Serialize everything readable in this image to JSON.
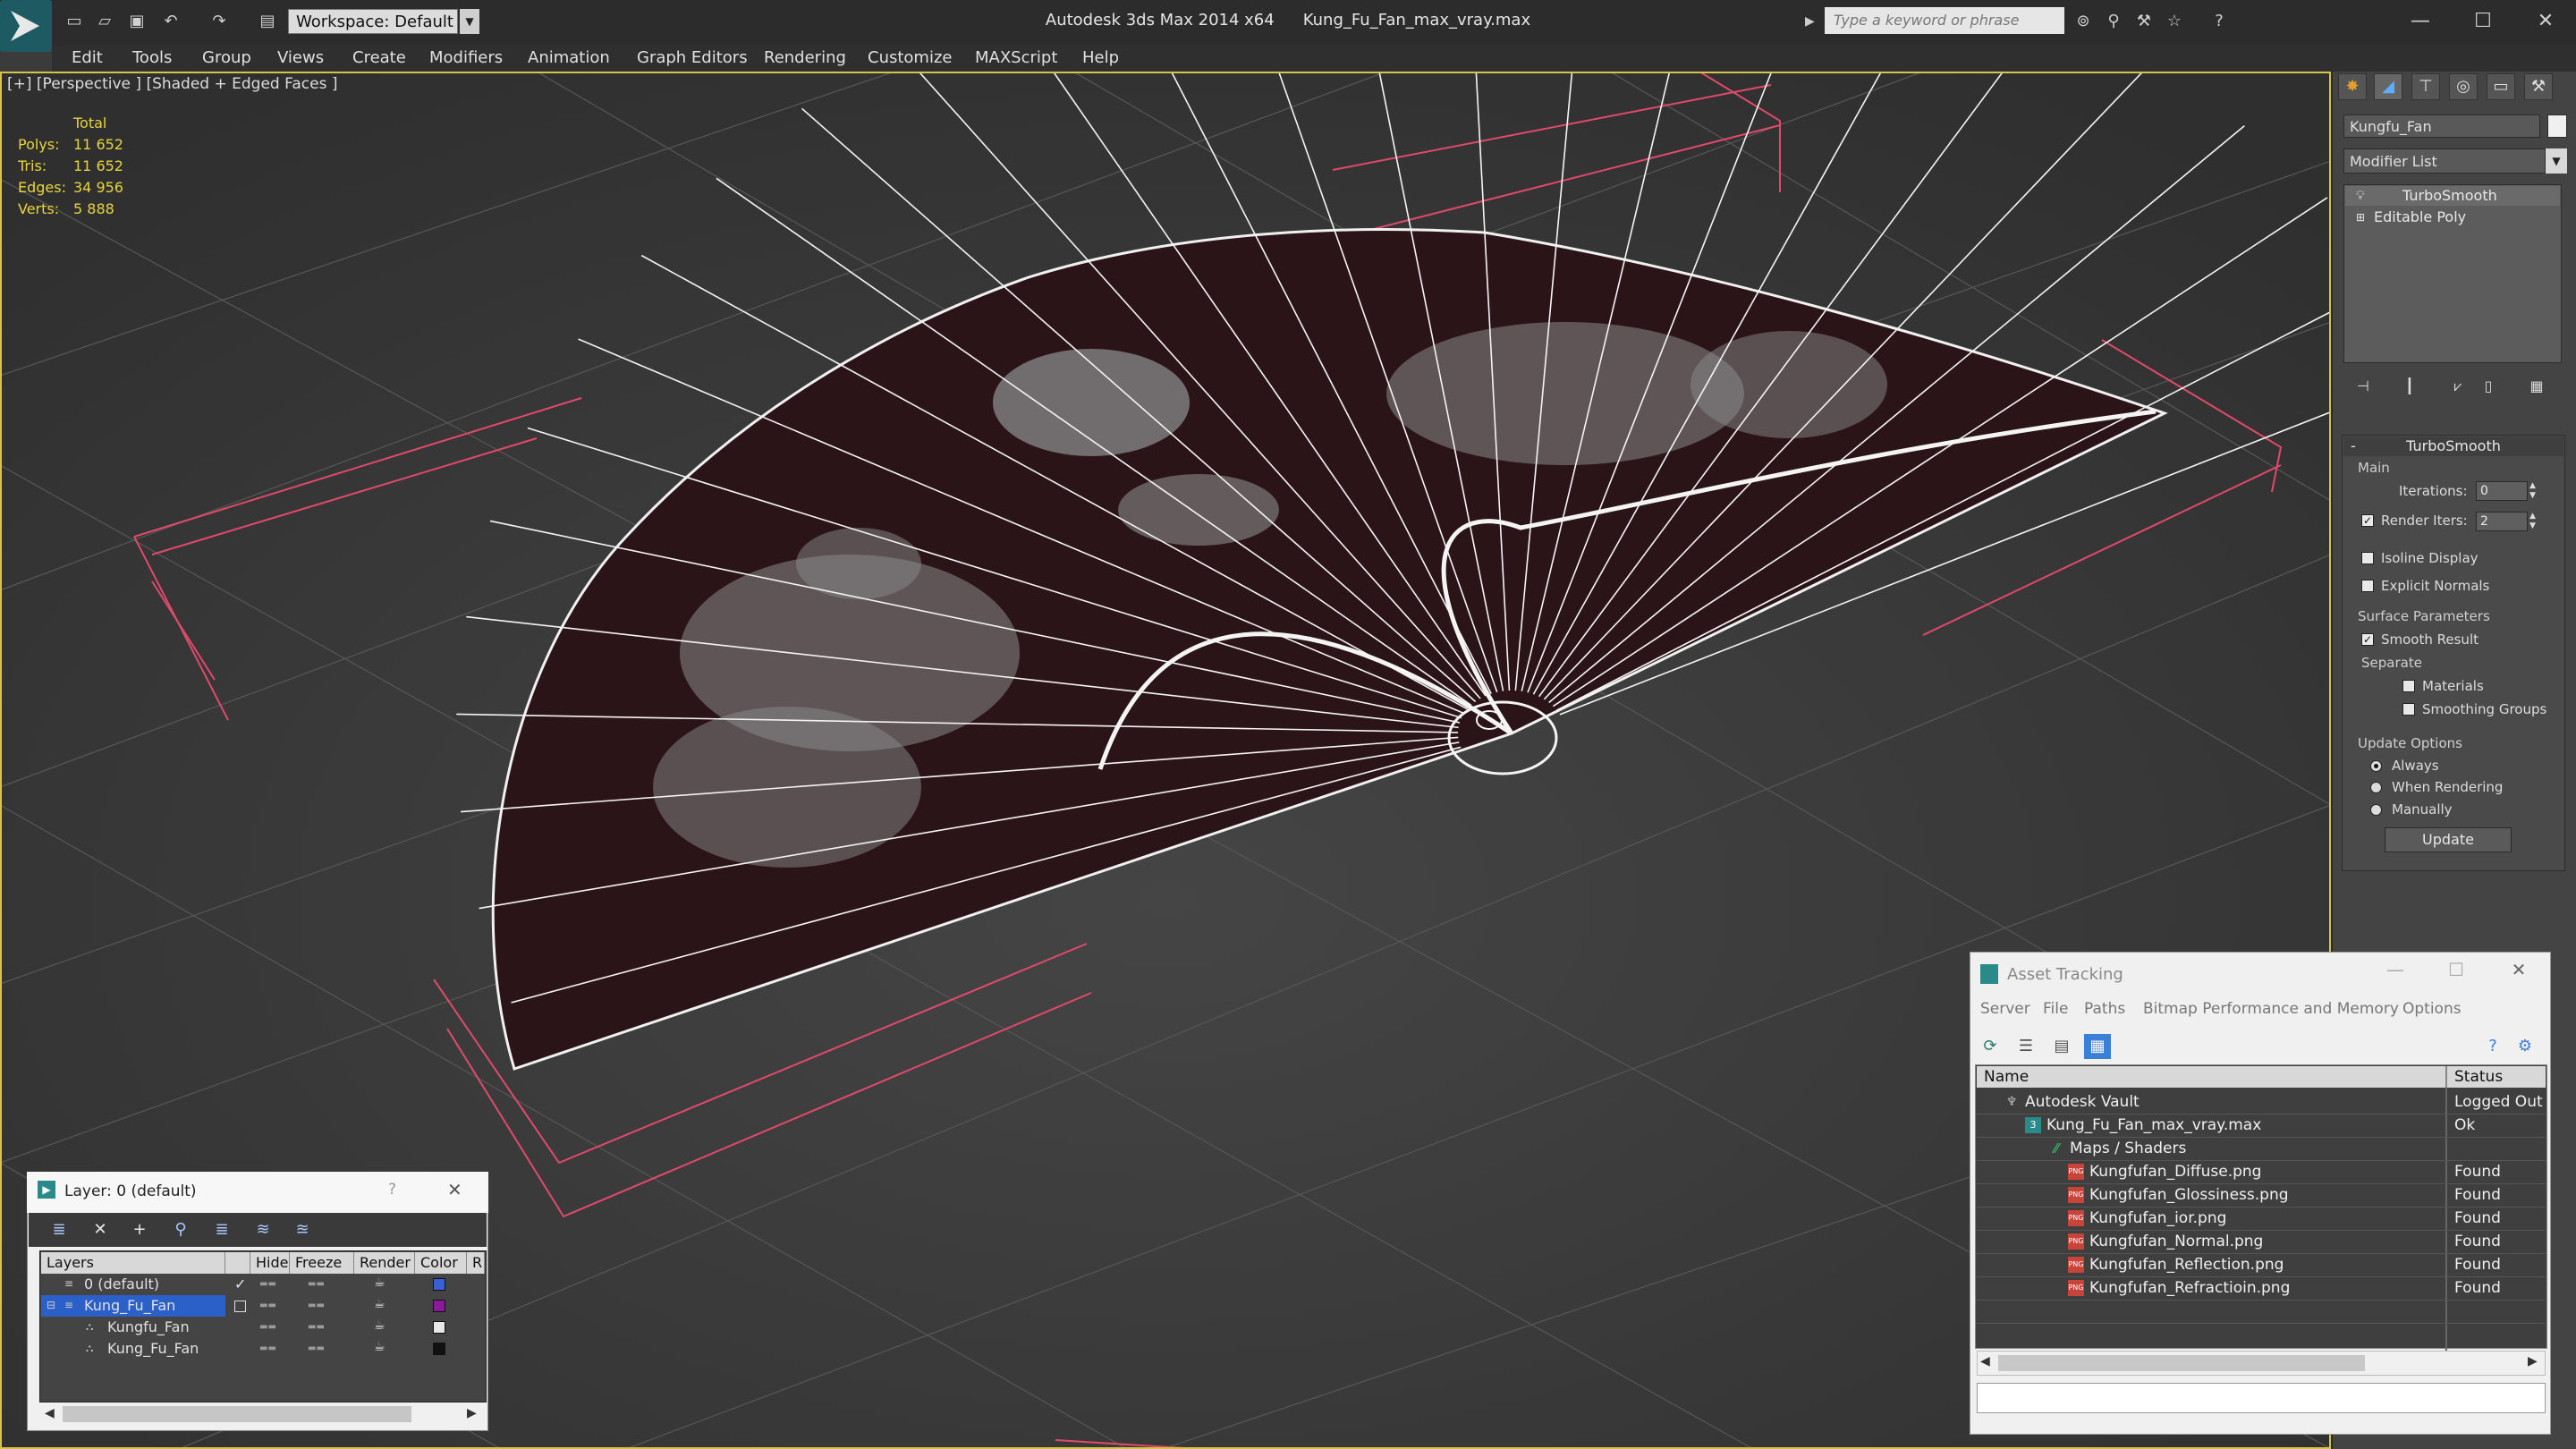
{
  "window": {
    "app_title": "Autodesk 3ds Max  2014 x64",
    "file_name": "Kung_Fu_Fan_max_vray.max",
    "minimize": "—",
    "maximize": "☐",
    "close": "✕"
  },
  "toolbar": {
    "workspace_label": "Workspace: Default",
    "search_placeholder": "Type a keyword or phrase",
    "help_icon": "?"
  },
  "menu": [
    "Edit",
    "Tools",
    "Group",
    "Views",
    "Create",
    "Modifiers",
    "Animation",
    "Graph Editors",
    "Rendering",
    "Customize",
    "MAXScript",
    "Help"
  ],
  "viewport": {
    "label": "[+] [Perspective ] [Shaded + Edged Faces ]",
    "stats": {
      "header": "Total",
      "rows": [
        {
          "label": "Polys:",
          "value": "11 652"
        },
        {
          "label": "Tris:",
          "value": "11 652"
        },
        {
          "label": "Edges:",
          "value": "34 956"
        },
        {
          "label": "Verts:",
          "value": "5 888"
        }
      ]
    }
  },
  "command_panel": {
    "object_name": "Kungfu_Fan",
    "object_color": "#ffffff",
    "modifier_list_label": "Modifier List",
    "stack": [
      "TurboSmooth",
      "Editable Poly"
    ],
    "turbosmooth": {
      "title": "TurboSmooth",
      "main_label": "Main",
      "iterations_label": "Iterations:",
      "iterations_value": "0",
      "render_iters_label": "Render Iters:",
      "render_iters_value": "2",
      "render_iters_checked": true,
      "isoline_label": "Isoline Display",
      "explicit_normals_label": "Explicit Normals",
      "surface_params_label": "Surface Parameters",
      "smooth_result_label": "Smooth Result",
      "separate_label": "Separate",
      "materials_label": "Materials",
      "smoothing_groups_label": "Smoothing Groups",
      "update_options_label": "Update Options",
      "always_label": "Always",
      "when_rendering_label": "When Rendering",
      "manually_label": "Manually",
      "update_button": "Update"
    }
  },
  "layer_window": {
    "title": "Layer: 0 (default)",
    "help": "?",
    "close": "✕",
    "columns": [
      "Layers",
      "Hide",
      "Freeze",
      "Render",
      "Color",
      "R"
    ],
    "rows": [
      {
        "name": "0 (default)",
        "color": "#3a5fd8"
      },
      {
        "name": "Kung_Fu_Fan",
        "color": "#8a1a9a"
      },
      {
        "name": "Kungfu_Fan",
        "color": "#e8e8e8"
      },
      {
        "name": "Kung_Fu_Fan",
        "color": "#111111"
      }
    ]
  },
  "asset_tracking": {
    "title": "Asset Tracking",
    "menu": [
      "Server",
      "File",
      "Paths",
      "Bitmap Performance and Memory",
      "Options"
    ],
    "columns": [
      "Name",
      "Status"
    ],
    "rows": [
      {
        "name": "Autodesk Vault",
        "status": "Logged Out"
      },
      {
        "name": "Kung_Fu_Fan_max_vray.max",
        "status": "Ok"
      },
      {
        "name": "Maps / Shaders",
        "status": ""
      },
      {
        "name": "Kungfufan_Diffuse.png",
        "status": "Found"
      },
      {
        "name": "Kungfufan_Glossiness.png",
        "status": "Found"
      },
      {
        "name": "Kungfufan_ior.png",
        "status": "Found"
      },
      {
        "name": "Kungfufan_Normal.png",
        "status": "Found"
      },
      {
        "name": "Kungfufan_Reflection.png",
        "status": "Found"
      },
      {
        "name": "Kungfufan_Refractioin.png",
        "status": "Found"
      }
    ]
  }
}
